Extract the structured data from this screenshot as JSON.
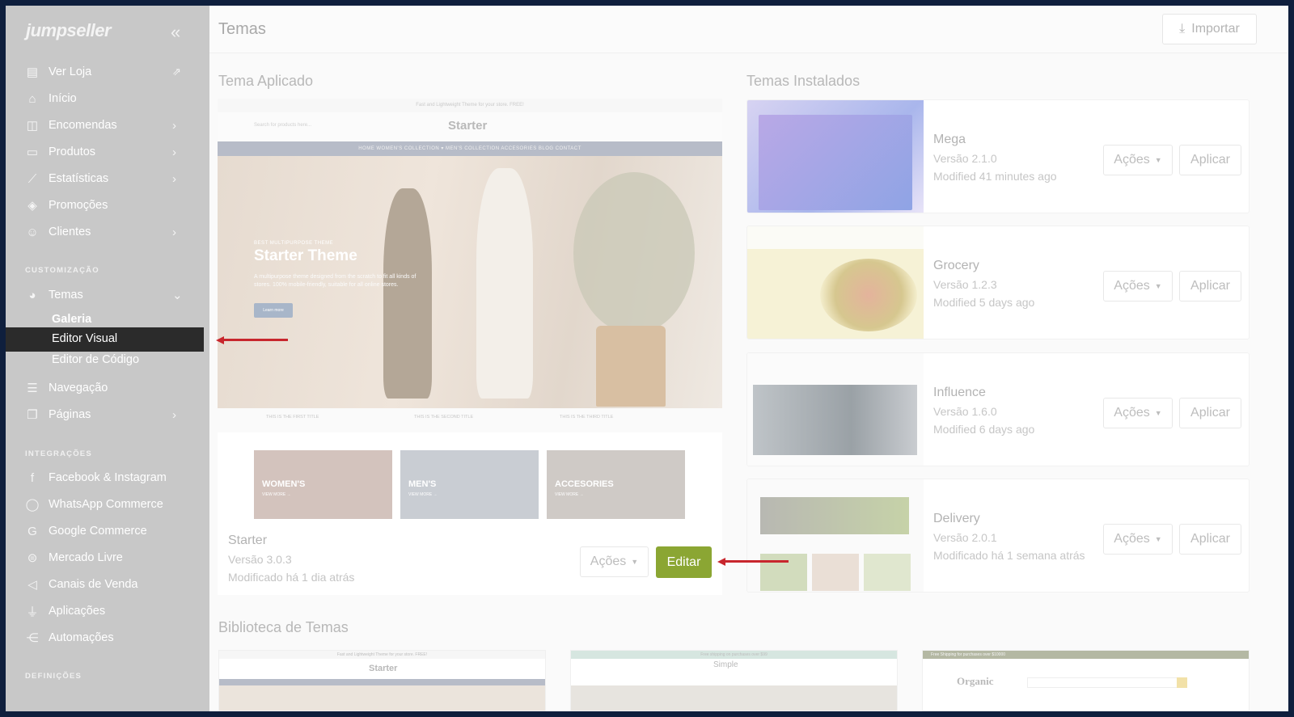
{
  "sidebar": {
    "logo": "jumpseller",
    "collapse_icon": "«",
    "items": [
      {
        "label": "Ver Loja",
        "icon": "store-icon"
      },
      {
        "label": "Início",
        "icon": "home-icon"
      },
      {
        "label": "Encomendas",
        "icon": "bag-icon"
      },
      {
        "label": "Produtos",
        "icon": "box-icon"
      },
      {
        "label": "Estatísticas",
        "icon": "chart-icon"
      },
      {
        "label": "Promoções",
        "icon": "tag-icon"
      },
      {
        "label": "Clientes",
        "icon": "users-icon"
      }
    ],
    "section_customization": "CUSTOMIZAÇÃO",
    "temas": {
      "label": "Temas",
      "sub": [
        "Galeria",
        "Editor Visual",
        "Editor de Código"
      ]
    },
    "nav2": [
      {
        "label": "Navegação"
      },
      {
        "label": "Páginas"
      }
    ],
    "section_integrations": "INTEGRAÇÕES",
    "integrations": [
      {
        "label": "Facebook & Instagram"
      },
      {
        "label": "WhatsApp Commerce"
      },
      {
        "label": "Google Commerce"
      },
      {
        "label": "Mercado Livre"
      },
      {
        "label": "Canais de Venda"
      },
      {
        "label": "Aplicações"
      },
      {
        "label": "Automações"
      }
    ],
    "section_settings": "DEFINIÇÕES"
  },
  "header": {
    "title": "Temas",
    "import_label": "Importar"
  },
  "applied": {
    "heading": "Tema Aplicado",
    "preview": {
      "topline": "Fast and Lightweight Theme for your store. FREE!",
      "brand": "Starter",
      "search": "Search for products here...",
      "nav": "HOME   WOMEN'S COLLECTION ▾   MEN'S COLLECTION   ACCESORIES   BLOG   CONTACT",
      "hero_tag": "BEST MULTIPURPOSE THEME",
      "hero_title": "Starter Theme",
      "hero_desc": "A multipurpose theme designed from the scratch to fit all kinds of stores. 100% mobile-friendly, suitable for all online stores.",
      "hero_cta": "Learn more",
      "features": [
        "THIS IS THE FIRST TITLE",
        "THIS IS THE SECOND TITLE",
        "THIS IS THE THIRD TITLE"
      ],
      "categories": [
        "WOMEN'S",
        "MEN'S",
        "ACCESORIES"
      ],
      "view_more": "VIEW MORE →"
    },
    "name": "Starter",
    "version": "Versão 3.0.3",
    "modified": "Modificado há 1 dia atrás",
    "acoes_label": "Ações",
    "editar_label": "Editar"
  },
  "installed": {
    "heading": "Temas Instalados",
    "acoes_label": "Ações",
    "aplicar_label": "Aplicar",
    "themes": [
      {
        "name": "Mega",
        "version": "Versão 2.1.0",
        "modified": "Modified 41 minutes ago"
      },
      {
        "name": "Grocery",
        "version": "Versão 1.2.3",
        "modified": "Modified 5 days ago"
      },
      {
        "name": "Influence",
        "version": "Versão 1.6.0",
        "modified": "Modified 6 days ago"
      },
      {
        "name": "Delivery",
        "version": "Versão 2.0.1",
        "modified": "Modificado há 1 semana atrás"
      }
    ]
  },
  "library": {
    "heading": "Biblioteca de Temas",
    "items": [
      {
        "brand": "Starter",
        "topline": "Fast and Lightweight Theme for your store. FREE!"
      },
      {
        "brand": "Simple",
        "topline": "Free shipping on purchases over $99"
      },
      {
        "brand": "Organic",
        "topline": "Free Shipping for purchases over $10000"
      }
    ]
  },
  "colors": {
    "accent": "#8ba633",
    "arrow": "#c8262d",
    "frame": "#0f1f3d"
  }
}
